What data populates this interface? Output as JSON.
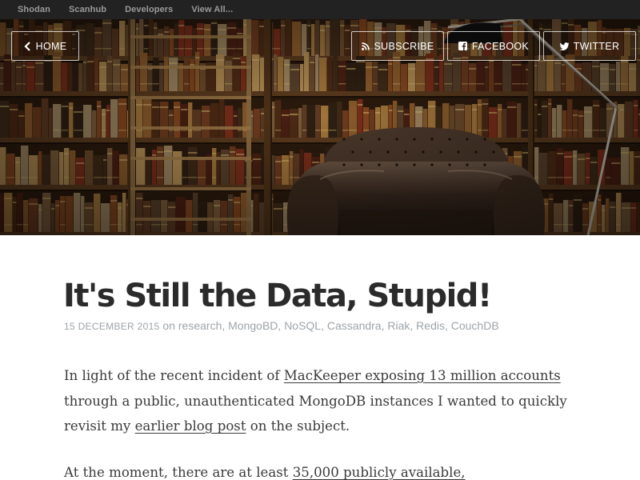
{
  "topnav": {
    "items": [
      "Shodan",
      "Scanhub",
      "Developers",
      "View All..."
    ]
  },
  "hero": {
    "home_label": "HOME",
    "subscribe_label": "SUBSCRIBE",
    "facebook_label": "FACEBOOK",
    "twitter_label": "TWITTER"
  },
  "post": {
    "title": "It's Still the Data, Stupid!",
    "date": "15 DECEMBER 2015",
    "on_word": "on",
    "tags": [
      "research",
      "MongoBD",
      "NoSQL",
      "Cassandra",
      "Riak",
      "Redis",
      "CouchDB"
    ],
    "p1": {
      "before": "In light of the recent incident of ",
      "link1": "MacKeeper exposing 13 million accounts",
      "middle": " through a public, unauthenticated MongoDB instances I wanted to quickly revisit my ",
      "link2": "earlier blog post",
      "after": " on the subject."
    },
    "p2": {
      "before": "At the moment, there are at least ",
      "link": "35,000 publicly available,"
    }
  },
  "colors": {
    "topbar_bg": "#222222",
    "title": "#2b2b2b",
    "meta": "#9da4a9",
    "body_text": "#3a3a3a"
  },
  "icons": [
    "chevron-left-icon",
    "rss-icon",
    "facebook-icon",
    "twitter-icon"
  ]
}
